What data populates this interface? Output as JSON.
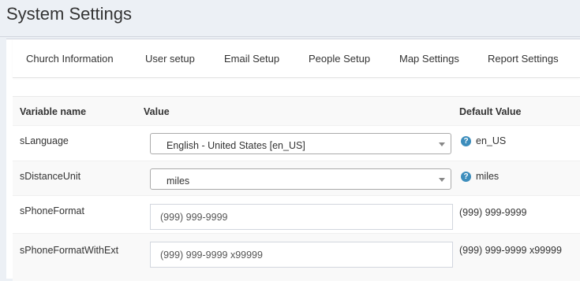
{
  "page": {
    "title": "System Settings"
  },
  "tabs": [
    {
      "label": "Church Information"
    },
    {
      "label": "User setup"
    },
    {
      "label": "Email Setup"
    },
    {
      "label": "People Setup"
    },
    {
      "label": "Map Settings"
    },
    {
      "label": "Report Settings"
    }
  ],
  "table": {
    "headers": {
      "variable": "Variable name",
      "value": "Value",
      "default": "Default Value"
    },
    "rows": [
      {
        "name": "sLanguage",
        "type": "select",
        "value": "English - United States [en_US]",
        "default": "en_US",
        "help_icon": "question-circle-icon"
      },
      {
        "name": "sDistanceUnit",
        "type": "select",
        "value": "miles",
        "default": "miles",
        "help_icon": "question-circle-icon"
      },
      {
        "name": "sPhoneFormat",
        "type": "text",
        "value": "(999) 999-9999",
        "default": "(999) 999-9999"
      },
      {
        "name": "sPhoneFormatWithExt",
        "type": "text",
        "value": "(999) 999-9999 x99999",
        "default": "(999) 999-9999 x99999"
      }
    ]
  },
  "colors": {
    "accent": "#3c8dbc",
    "background": "#ecf0f5"
  }
}
